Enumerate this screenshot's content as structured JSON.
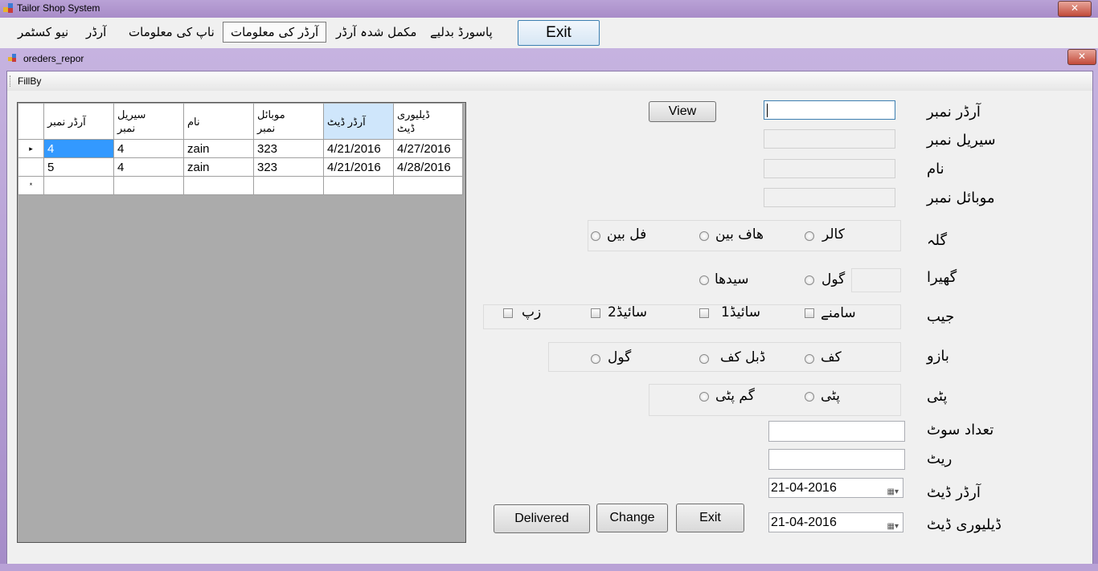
{
  "window": {
    "title": "Tailor Shop System",
    "close": "✕"
  },
  "menu": {
    "items": [
      "نیو کسٹمر",
      "آرڈر",
      "ناپ کی معلومات",
      "آرڈر کی معلومات",
      "مکمل شدہ آرڈر",
      "پاسورڈ بدلیے"
    ],
    "active_index": 3,
    "exit_label": "Exit"
  },
  "child": {
    "title": "oreders_repor",
    "close": "✕"
  },
  "toolstrip": {
    "fillby": "FillBy"
  },
  "grid": {
    "columns": [
      "آرڈر نمبر",
      "سیریل\nنمبر",
      "نام",
      "موبائل\nنمبر",
      "آرڈر ڈیٹ",
      "ڈیلیوری\nڈیٹ"
    ],
    "rows": [
      [
        "4",
        "4",
        "zain",
        "323",
        "4/21/2016",
        "4/27/2016"
      ],
      [
        "5",
        "4",
        "zain",
        "323",
        "4/21/2016",
        "4/28/2016"
      ]
    ],
    "current_row_marker": "▸",
    "new_row_marker": "*"
  },
  "form": {
    "order_no_label": "آرڈر نمبر",
    "serial_no_label": "سیریل نمبر",
    "name_label": "نام",
    "mobile_label": "موبائل نمبر",
    "view_label": "View",
    "collar": {
      "label": "گلہ",
      "options": [
        "کالر",
        "ھاف بین",
        "فل بین"
      ]
    },
    "hem": {
      "label": "گھیرا",
      "options": [
        "گول",
        "سیدھا"
      ]
    },
    "pocket": {
      "label": "جیب",
      "options": [
        "سامنے",
        "1سائیڈ",
        "2سائیڈ",
        "زپ"
      ]
    },
    "sleeve": {
      "label": "بازو",
      "options": [
        "کف",
        "ڈبل کف",
        "گول"
      ]
    },
    "patti": {
      "label": "پٹی",
      "options": [
        "پٹی",
        "گم پٹی"
      ]
    },
    "suits_label": "تعداد سوٹ",
    "rate_label": "ریٹ",
    "order_date_label": "آرڈر ڈیٹ",
    "order_date_value": "21-04-2016",
    "delivery_date_label": "ڈیلیوری ڈیٹ",
    "delivery_date_value": "21-04-2016",
    "delivered_label": "Delivered",
    "change_label": "Change",
    "exit_label": "Exit"
  }
}
